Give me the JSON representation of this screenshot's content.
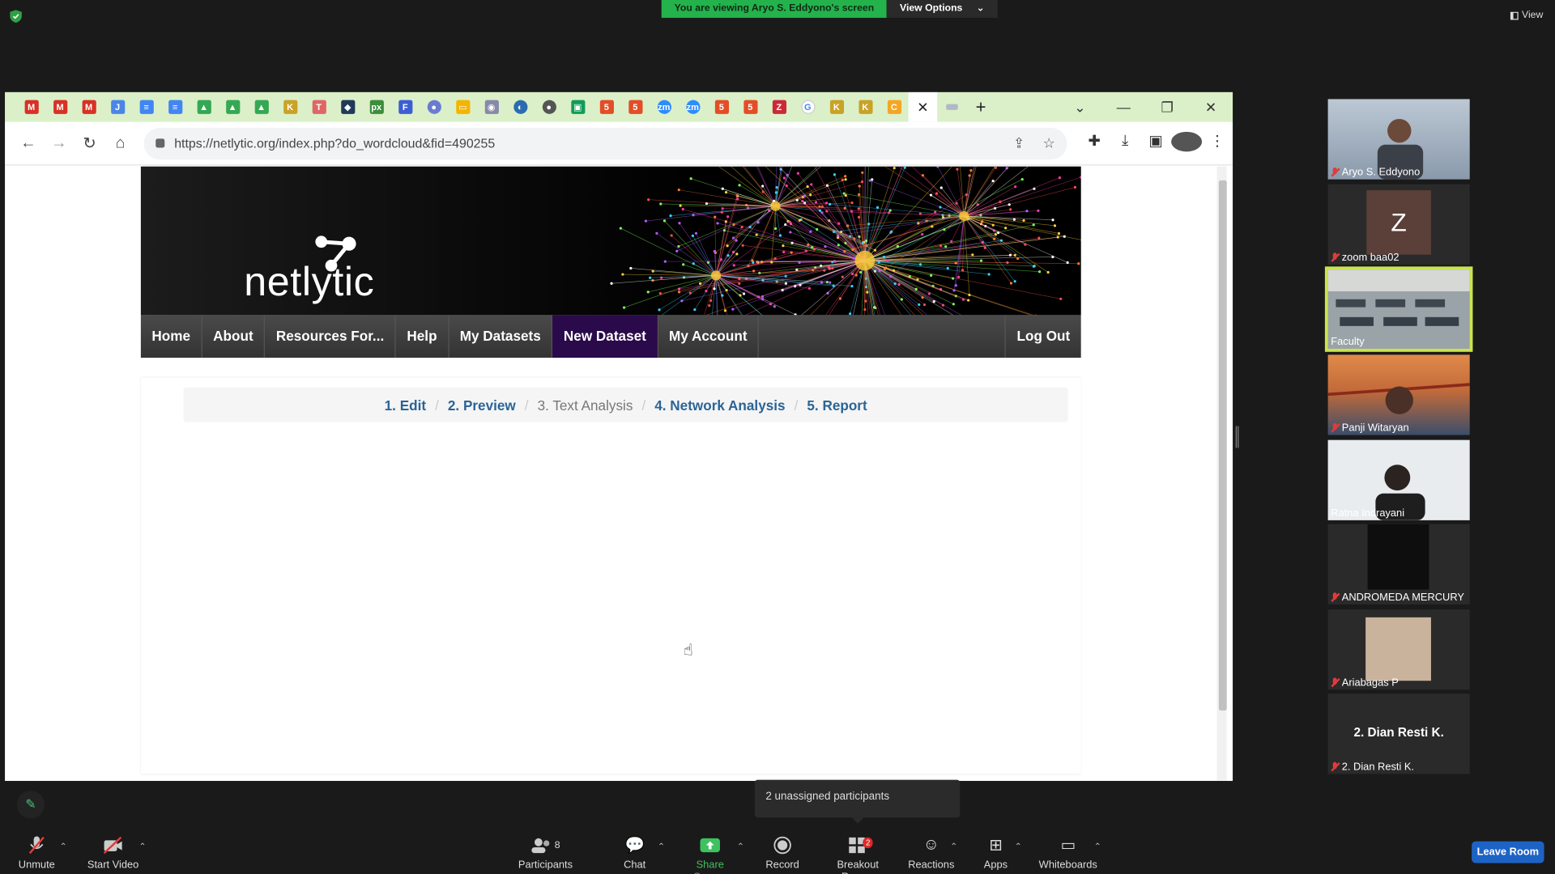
{
  "zoom_banner": {
    "viewing_text": "You are viewing Aryo S. Eddyono's screen",
    "view_options": "View Options",
    "view_label": "View"
  },
  "browser": {
    "tab_icons": [
      "gmail",
      "gmail",
      "gmail",
      "doc-j",
      "docs",
      "docs",
      "drive",
      "drive",
      "drive",
      "k",
      "t",
      "shield",
      "px",
      "forms",
      "person",
      "slides",
      "contact",
      "edge",
      "globe",
      "classroom",
      "html5",
      "html5",
      "zoom",
      "zoom",
      "html5",
      "html5",
      "zotero",
      "google",
      "k",
      "k",
      "c"
    ],
    "new_tab_icon": "+",
    "url": "https://netlytic.org/index.php?do_wordcloud&fid=490255"
  },
  "site": {
    "logo_text": "netlytic",
    "nav": [
      "Home",
      "About",
      "Resources For...",
      "Help",
      "My Datasets",
      "New Dataset",
      "My Account"
    ],
    "active_nav": "New Dataset",
    "logout": "Log Out",
    "steps": [
      "1. Edit",
      "2. Preview",
      "3. Text Analysis",
      "4. Network Analysis",
      "5. Report"
    ],
    "current_step": "3. Text Analysis"
  },
  "participants": [
    {
      "name": "Aryo S. Eddyono",
      "muted": true,
      "type": "video"
    },
    {
      "name": "zoom baa02",
      "muted": true,
      "type": "avatar",
      "initial": "Z"
    },
    {
      "name": "Faculty",
      "muted": false,
      "type": "video",
      "selected": true
    },
    {
      "name": "Panji Witaryan",
      "muted": true,
      "type": "video"
    },
    {
      "name": "Ratna Indrayani",
      "muted": false,
      "type": "video"
    },
    {
      "name": "ANDROMEDA MERCURY",
      "muted": true,
      "type": "video"
    },
    {
      "name": "Ariabagas P",
      "muted": true,
      "type": "video"
    },
    {
      "name": "2. Dian Resti K.",
      "muted": true,
      "type": "name",
      "display_name": "2. Dian Resti K."
    }
  ],
  "popup": {
    "unassigned": "2 unassigned participants"
  },
  "zoom_toolbar": {
    "unmute": "Unmute",
    "start_video": "Start Video",
    "participants": "Participants",
    "participants_count": "8",
    "chat": "Chat",
    "share_screen": "Share Screen",
    "record": "Record",
    "breakout_rooms": "Breakout Rooms",
    "breakout_badge": "2",
    "reactions": "Reactions",
    "apps": "Apps",
    "whiteboards": "Whiteboards",
    "leave_room": "Leave Room"
  },
  "colors": {
    "zoom_bg": "#1a1a1a",
    "banner_green": "#24b24c",
    "tabbar": "#dbf0c8",
    "nav_active": "#2a0a4a",
    "step_link": "#2a6496",
    "leave_button": "#1d63c6"
  }
}
